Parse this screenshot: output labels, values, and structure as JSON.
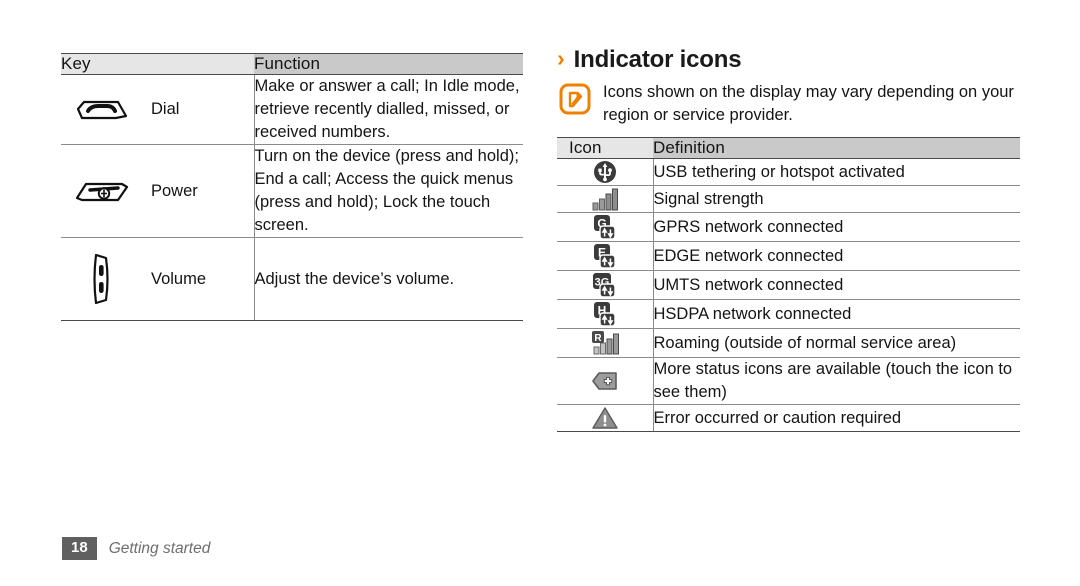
{
  "left_table": {
    "headers": [
      "Key",
      "Function"
    ],
    "rows": [
      {
        "icon": "dial-key-icon",
        "key": "Dial",
        "function": "Make or answer a call; In Idle mode, retrieve recently dialled, missed, or received numbers."
      },
      {
        "icon": "power-key-icon",
        "key": "Power",
        "function": "Turn on the device (press and hold); End a call; Access the quick menus (press and hold); Lock the touch screen."
      },
      {
        "icon": "volume-key-icon",
        "key": "Volume",
        "function": "Adjust the device’s volume."
      }
    ]
  },
  "section": {
    "chevron": "›",
    "title": "Indicator icons"
  },
  "note": {
    "icon": "note-pencil-icon",
    "text": "Icons shown on the display may vary depending on your region or service provider."
  },
  "right_table": {
    "headers": [
      "Icon",
      "Definition"
    ],
    "rows": [
      {
        "icon": "usb-tethering-icon",
        "definition": "USB tethering or hotspot activated"
      },
      {
        "icon": "signal-strength-icon",
        "definition": "Signal strength"
      },
      {
        "icon": "gprs-network-icon",
        "definition": "GPRS network connected"
      },
      {
        "icon": "edge-network-icon",
        "definition": "EDGE network connected"
      },
      {
        "icon": "umts-network-icon",
        "definition": "UMTS network connected"
      },
      {
        "icon": "hsdpa-network-icon",
        "definition": "HSDPA network connected"
      },
      {
        "icon": "roaming-icon",
        "definition": "Roaming (outside of normal service area)"
      },
      {
        "icon": "more-status-icons-icon",
        "definition": "More status icons are available (touch the icon to see them)"
      },
      {
        "icon": "warning-icon",
        "definition": "Error occurred or caution required"
      }
    ]
  },
  "footer": {
    "page": "18",
    "label": "Getting started"
  },
  "colors": {
    "accent": "#f08000",
    "header_light": "#e6e6e6",
    "header_dark": "#c9c9c9",
    "rule": "#4a4a4a",
    "text": "#141414"
  }
}
